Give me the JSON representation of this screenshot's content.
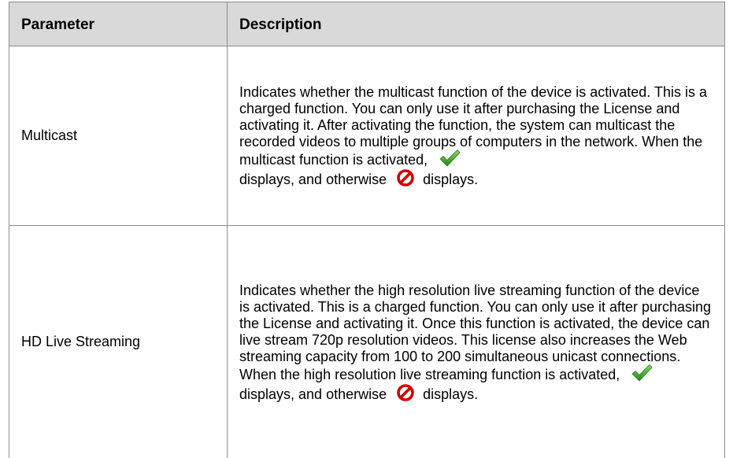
{
  "table": {
    "headers": {
      "parameter": "Parameter",
      "description": "Description"
    },
    "rows": [
      {
        "parameter": "Multicast",
        "description_main": "Indicates whether the multicast function of the device is activated. This is a charged function. You can only use it after purchasing the License and activating it. After activating the function, the system can multicast the recorded videos to multiple groups of computers in the network. When the multicast function is activated,",
        "description_after_check": "displays, and otherwise",
        "description_end": "displays."
      },
      {
        "parameter": "HD Live Streaming",
        "description_main": "Indicates whether the high resolution live streaming function of the device is activated. This is a charged function. You can only use it after purchasing the License and activating it. Once this function is activated, the device can live stream 720p resolution videos. This license also increases the Web streaming capacity from 100 to 200 simultaneous unicast connections. When the high resolution live streaming function is activated,",
        "description_after_check": "displays, and otherwise",
        "description_end": "displays."
      }
    ]
  },
  "icons": {
    "activated": "checkmark-icon",
    "not_activated": "prohibited-icon"
  },
  "colors": {
    "header_background": "#d9d9d9",
    "border": "#8c8c8c",
    "check_green": "#2f9e1f",
    "prohibited_red": "#d40000"
  }
}
